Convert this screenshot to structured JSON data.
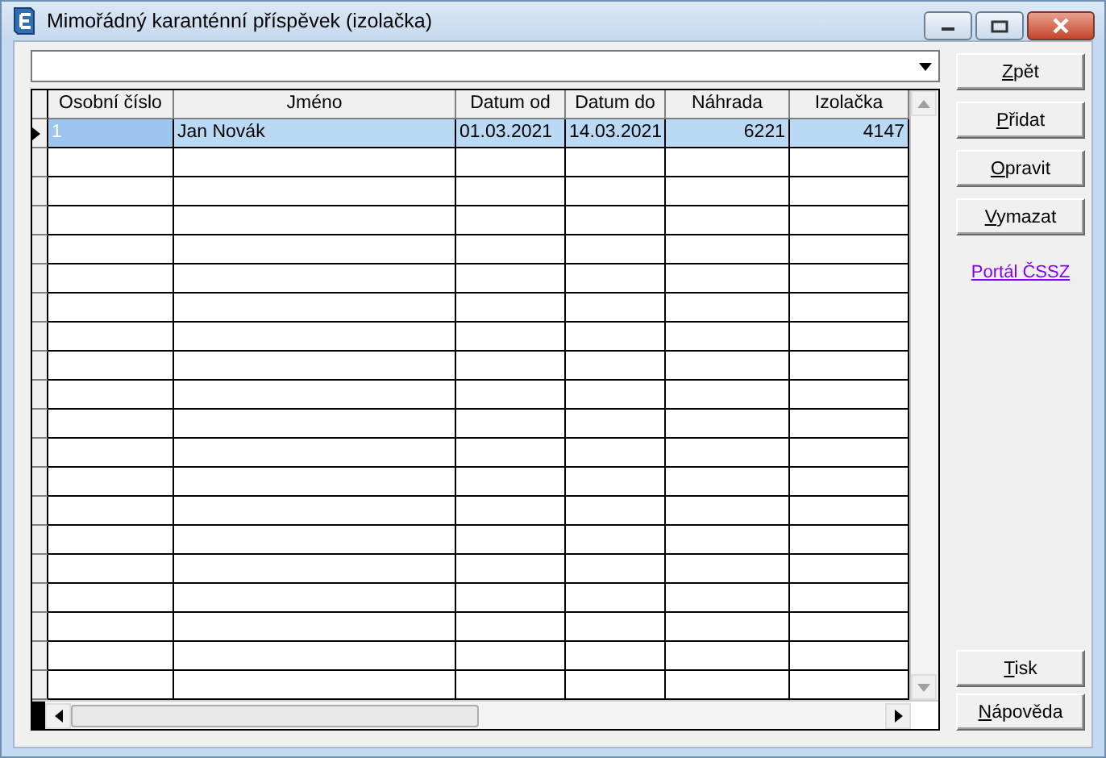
{
  "window": {
    "title": "Mimořádný karanténní příspěvek (izolačka)"
  },
  "table": {
    "columns": [
      {
        "label": "Osobní číslo"
      },
      {
        "label": "Jméno"
      },
      {
        "label": "Datum od"
      },
      {
        "label": "Datum do"
      },
      {
        "label": "Náhrada"
      },
      {
        "label": "Izolačka"
      }
    ],
    "rows": [
      {
        "selected": true,
        "cells": [
          "1",
          "Jan Novák",
          "01.03.2021",
          "14.03.2021",
          "6221",
          "4147"
        ]
      }
    ]
  },
  "actions_top": [
    "Zpět",
    "Přidat",
    "Opravit",
    "Vymazat"
  ],
  "link": "Portál ČSSZ",
  "actions_bottom": [
    "Tisk",
    "Nápověda"
  ]
}
